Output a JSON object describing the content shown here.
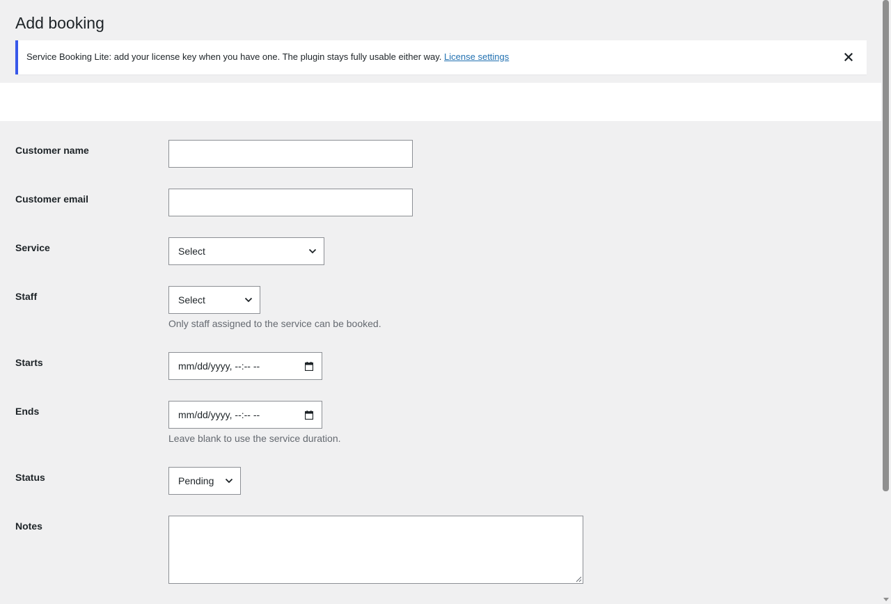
{
  "page": {
    "title": "Add booking"
  },
  "notice": {
    "text": "Service Booking Lite: add your license key when you have one. The plugin stays fully usable either way.",
    "link_label": "License settings",
    "dismiss_icon": "close-icon",
    "accent_color": "#3858e9"
  },
  "form": {
    "customer_name": {
      "label": "Customer name",
      "value": ""
    },
    "customer_email": {
      "label": "Customer email",
      "value": ""
    },
    "service": {
      "label": "Service",
      "selected": "Select"
    },
    "staff": {
      "label": "Staff",
      "selected": "Select",
      "description": "Only staff assigned to the service can be booked."
    },
    "starts": {
      "label": "Starts",
      "placeholder": "mm/dd/yyyy, --:-- --"
    },
    "ends": {
      "label": "Ends",
      "placeholder": "mm/dd/yyyy, --:-- --",
      "description": "Leave blank to use the service duration."
    },
    "status": {
      "label": "Status",
      "selected": "Pending"
    },
    "notes": {
      "label": "Notes",
      "value": ""
    }
  },
  "icons": {
    "dropdown": "chevron-down-icon",
    "calendar": "calendar-icon"
  }
}
